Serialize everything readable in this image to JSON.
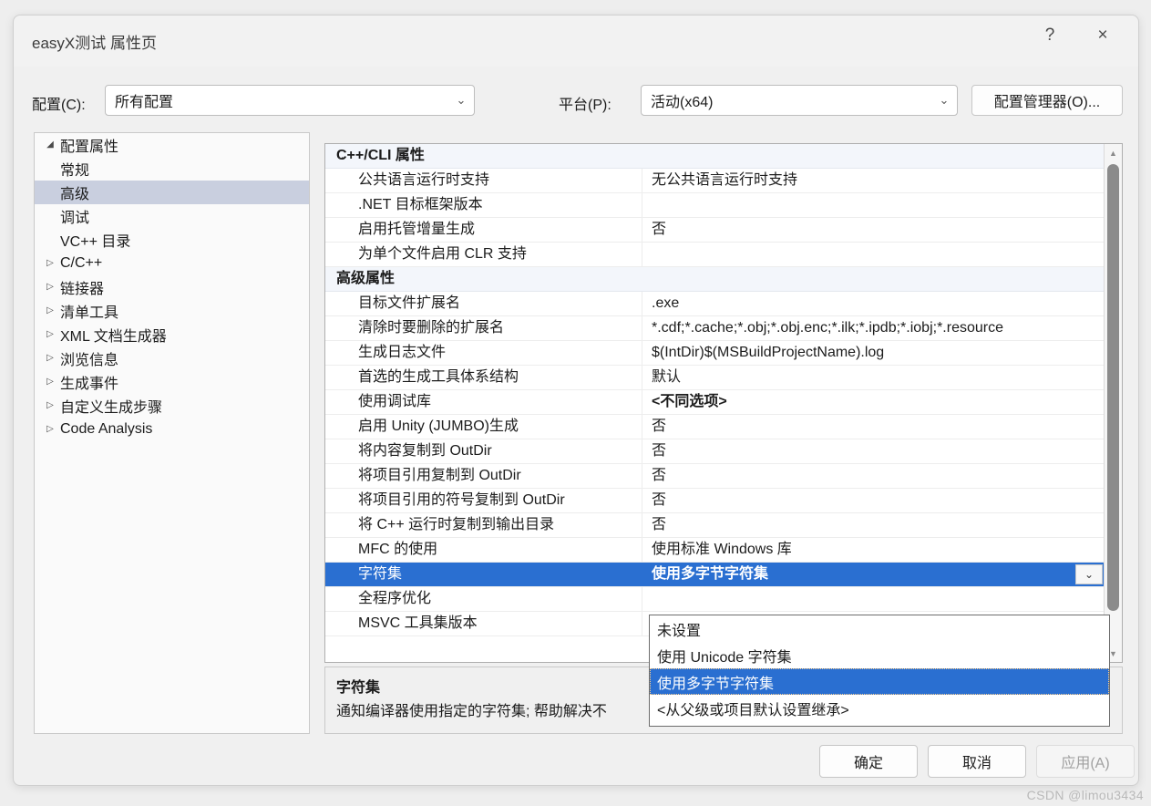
{
  "window": {
    "title": "easyX测试 属性页",
    "help_icon": "?",
    "close_icon": "×"
  },
  "config_bar": {
    "config_label": "配置(C):",
    "config_value": "所有配置",
    "platform_label": "平台(P):",
    "platform_value": "活动(x64)",
    "config_manager_button": "配置管理器(O)...",
    "chevron": "⌄"
  },
  "tree": {
    "items": [
      {
        "label": "配置属性",
        "level": 0,
        "twisty": "◢",
        "expanded": true,
        "selected": false
      },
      {
        "label": "常规",
        "level": 1,
        "twisty": "",
        "expanded": false,
        "selected": false
      },
      {
        "label": "高级",
        "level": 1,
        "twisty": "",
        "expanded": false,
        "selected": true
      },
      {
        "label": "调试",
        "level": 1,
        "twisty": "",
        "expanded": false,
        "selected": false
      },
      {
        "label": "VC++ 目录",
        "level": 1,
        "twisty": "",
        "expanded": false,
        "selected": false
      },
      {
        "label": "C/C++",
        "level": 1,
        "twisty": "▷",
        "expanded": false,
        "selected": false
      },
      {
        "label": "链接器",
        "level": 1,
        "twisty": "▷",
        "expanded": false,
        "selected": false
      },
      {
        "label": "清单工具",
        "level": 1,
        "twisty": "▷",
        "expanded": false,
        "selected": false
      },
      {
        "label": "XML 文档生成器",
        "level": 1,
        "twisty": "▷",
        "expanded": false,
        "selected": false
      },
      {
        "label": "浏览信息",
        "level": 1,
        "twisty": "▷",
        "expanded": false,
        "selected": false
      },
      {
        "label": "生成事件",
        "level": 1,
        "twisty": "▷",
        "expanded": false,
        "selected": false
      },
      {
        "label": "自定义生成步骤",
        "level": 1,
        "twisty": "▷",
        "expanded": false,
        "selected": false
      },
      {
        "label": "Code Analysis",
        "level": 1,
        "twisty": "▷",
        "expanded": false,
        "selected": false
      }
    ]
  },
  "grid": {
    "rows": [
      {
        "kind": "category",
        "name": "C++/CLI 属性",
        "value": "",
        "twisty": "⌄"
      },
      {
        "kind": "prop",
        "name": "公共语言运行时支持",
        "value": "无公共语言运行时支持"
      },
      {
        "kind": "prop",
        "name": ".NET 目标框架版本",
        "value": ""
      },
      {
        "kind": "prop",
        "name": "启用托管增量生成",
        "value": "否"
      },
      {
        "kind": "prop",
        "name": "为单个文件启用 CLR 支持",
        "value": ""
      },
      {
        "kind": "category",
        "name": "高级属性",
        "value": "",
        "twisty": "⌄"
      },
      {
        "kind": "prop",
        "name": "目标文件扩展名",
        "value": ".exe"
      },
      {
        "kind": "prop",
        "name": "清除时要删除的扩展名",
        "value": "*.cdf;*.cache;*.obj;*.obj.enc;*.ilk;*.ipdb;*.iobj;*.resource"
      },
      {
        "kind": "prop",
        "name": "生成日志文件",
        "value": "$(IntDir)$(MSBuildProjectName).log"
      },
      {
        "kind": "prop",
        "name": "首选的生成工具体系结构",
        "value": "默认"
      },
      {
        "kind": "prop",
        "name": "使用调试库",
        "value": "<不同选项>",
        "value_bold": true
      },
      {
        "kind": "prop",
        "name": "启用 Unity (JUMBO)生成",
        "value": "否"
      },
      {
        "kind": "prop",
        "name": "将内容复制到 OutDir",
        "value": "否"
      },
      {
        "kind": "prop",
        "name": "将项目引用复制到 OutDir",
        "value": "否"
      },
      {
        "kind": "prop",
        "name": "将项目引用的符号复制到 OutDir",
        "value": "否"
      },
      {
        "kind": "prop",
        "name": "将 C++ 运行时复制到输出目录",
        "value": "否"
      },
      {
        "kind": "prop",
        "name": "MFC 的使用",
        "value": "使用标准 Windows 库"
      },
      {
        "kind": "prop",
        "name": "字符集",
        "value": "使用多字节字符集",
        "selected": true,
        "editor": "⌄"
      },
      {
        "kind": "prop",
        "name": "全程序优化",
        "value": ""
      },
      {
        "kind": "prop",
        "name": "MSVC 工具集版本",
        "value": ""
      }
    ],
    "scrollbar": {
      "up_arrow": "▲",
      "down_arrow": "▼"
    }
  },
  "dropdown": {
    "options": [
      {
        "label": "未设置",
        "selected": false
      },
      {
        "label": "使用 Unicode 字符集",
        "selected": false
      },
      {
        "label": "使用多字节字符集",
        "selected": true
      },
      {
        "label": "<从父级或项目默认设置继承>",
        "selected": false
      }
    ]
  },
  "description": {
    "title": "字符集",
    "text": "通知编译器使用指定的字符集; 帮助解决不"
  },
  "footer": {
    "ok": "确定",
    "cancel": "取消",
    "apply": "应用(A)"
  },
  "watermark": "CSDN @limou3434",
  "colors": {
    "accent_selection": "#2a6fd1",
    "tree_selection": "#c9cfdf",
    "category_bg": "#f3f6fb",
    "dialog_bg": "#f0f0f0"
  }
}
